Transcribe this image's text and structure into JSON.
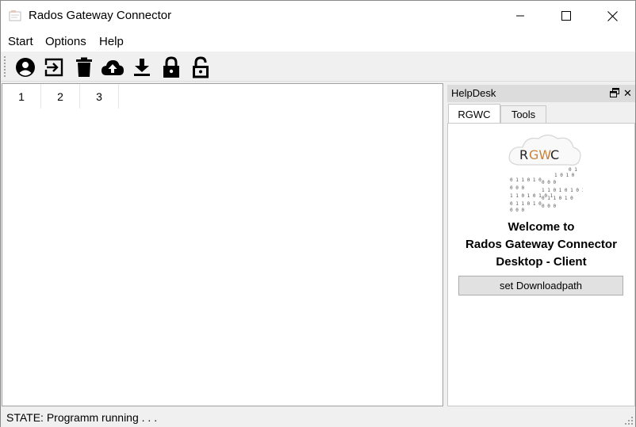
{
  "window": {
    "title": "Rados Gateway Connector"
  },
  "menu": {
    "items": [
      "Start",
      "Options",
      "Help"
    ]
  },
  "toolbar": {
    "icons": [
      "user-icon",
      "login-icon",
      "trash-icon",
      "cloud-upload-icon",
      "download-icon",
      "lock-icon",
      "unlock-icon"
    ]
  },
  "main": {
    "tabs": [
      "1",
      "2",
      "3"
    ]
  },
  "helpdesk": {
    "title": "HelpDesk",
    "tabs": [
      "RGWC",
      "Tools"
    ],
    "logo": {
      "text_r": "R",
      "text_gw": "GW",
      "text_c": "C"
    },
    "welcome_line1": "Welcome to",
    "welcome_line2": "Rados Gateway Connector",
    "welcome_line3": "Desktop - Client",
    "button_label": "set Downloadpath"
  },
  "status": {
    "text": "STATE: Programm running . . ."
  },
  "colors": {
    "logo_accent": "#c8813a",
    "window_bg": "#f0f0f0",
    "panel_bg": "#ffffff"
  }
}
